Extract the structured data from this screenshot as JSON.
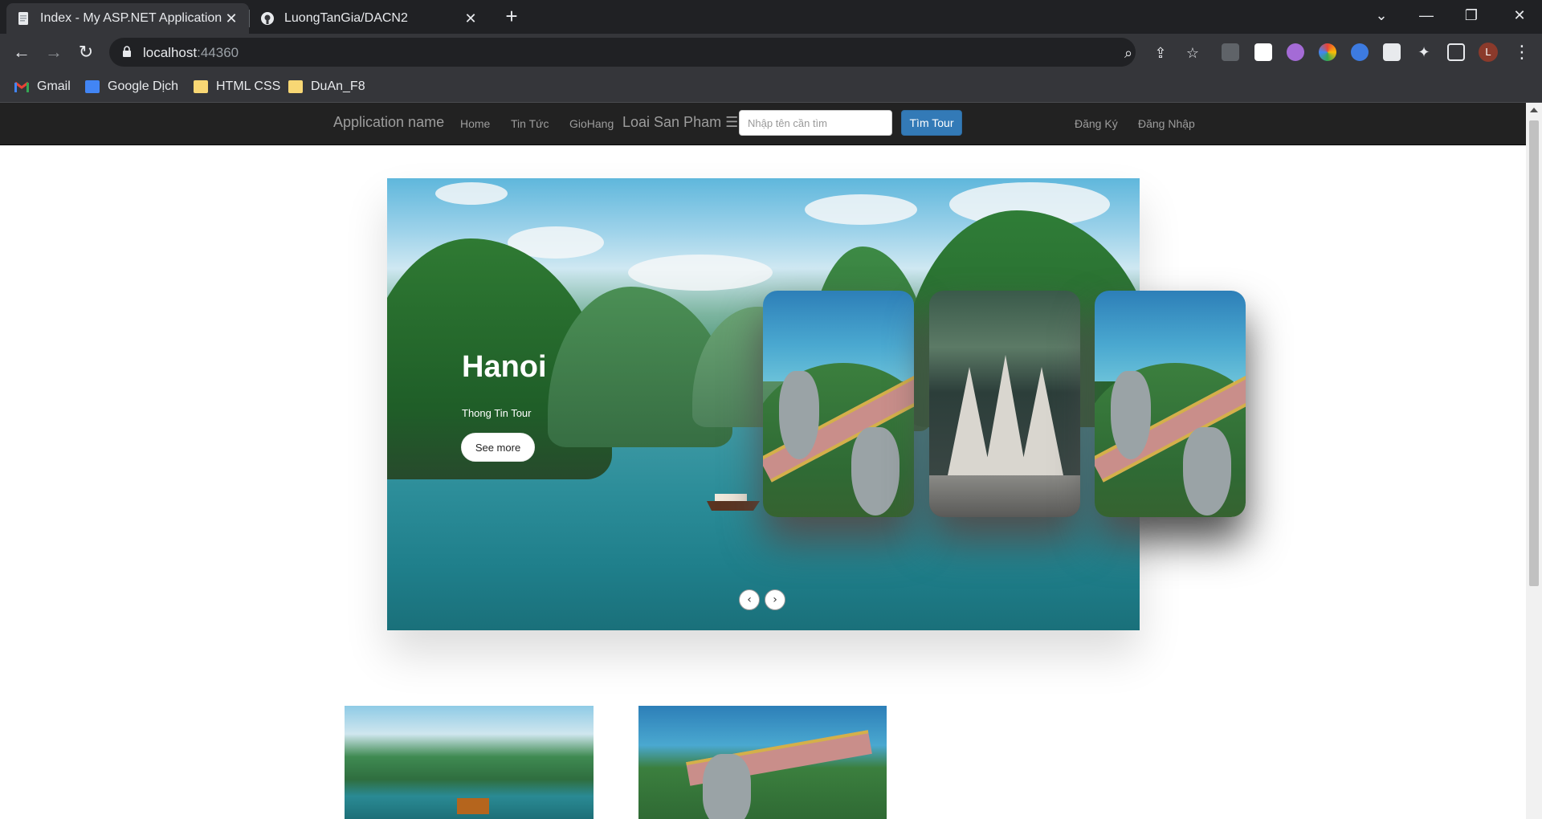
{
  "browser": {
    "tabs": [
      {
        "title": "Index - My ASP.NET Application",
        "active": true
      },
      {
        "title": "LuongTanGia/DACN2",
        "active": false
      }
    ],
    "url_host": "localhost",
    "url_port": ":44360",
    "profile_initial": "L",
    "bookmarks": [
      {
        "label": "Gmail",
        "icon": "gmail-icon"
      },
      {
        "label": "Google Dịch",
        "icon": "google-translate-icon"
      },
      {
        "label": "HTML CSS",
        "icon": "folder-icon"
      },
      {
        "label": "DuAn_F8",
        "icon": "folder-icon"
      }
    ],
    "extensions": [
      "camera-icon",
      "b-extension-icon",
      "purple-extension-icon",
      "color-wheel-icon",
      "blue-sync-icon",
      "search-ext-icon",
      "puzzle-icon",
      "side-panel-icon"
    ]
  },
  "app": {
    "brand": "Application name",
    "nav": {
      "home": "Home",
      "news": "Tin Tức",
      "cart": "GioHang",
      "category": "Loai San Pham ☰"
    },
    "search": {
      "placeholder": "Nhập tên cần tìm",
      "button": "Tìm Tour"
    },
    "auth": {
      "register": "Đăng Ký",
      "login": "Đăng Nhập"
    }
  },
  "hero": {
    "title": "Hanoi",
    "subtitle": "Thong Tin Tour",
    "button": "See more",
    "prev": "‹",
    "next": "›"
  },
  "colors": {
    "navbar": "#222222",
    "primary_button": "#337ab7",
    "chrome_dark": "#202124",
    "chrome_mid": "#35363a"
  }
}
